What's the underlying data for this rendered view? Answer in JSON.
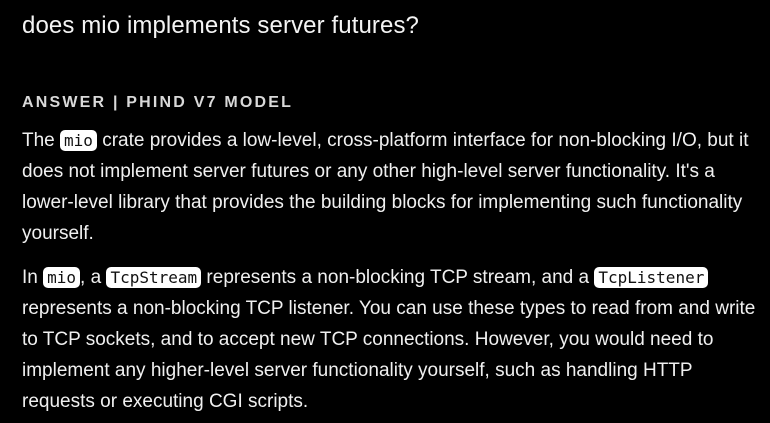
{
  "question": "does mio implements server futures?",
  "answer_header": "ANSWER | PHIND V7 MODEL",
  "paragraph1": {
    "t1": "The ",
    "code1": "mio",
    "t2": " crate provides a low-level, cross-platform interface for non-blocking I/O, but it does not implement server futures or any other high-level server functionality. It's a lower-level library that provides the building blocks for implementing such functionality yourself."
  },
  "paragraph2": {
    "t1": "In ",
    "code1": "mio",
    "t2": ", a ",
    "code2": "TcpStream",
    "t3": " represents a non-blocking TCP stream, and a ",
    "code3": "TcpListener",
    "t4": " represents a non-blocking TCP listener. You can use these types to read from and write to TCP sockets, and to accept new TCP connections. However, you would need to implement any higher-level server functionality yourself, such as handling HTTP requests or executing CGI scripts."
  }
}
